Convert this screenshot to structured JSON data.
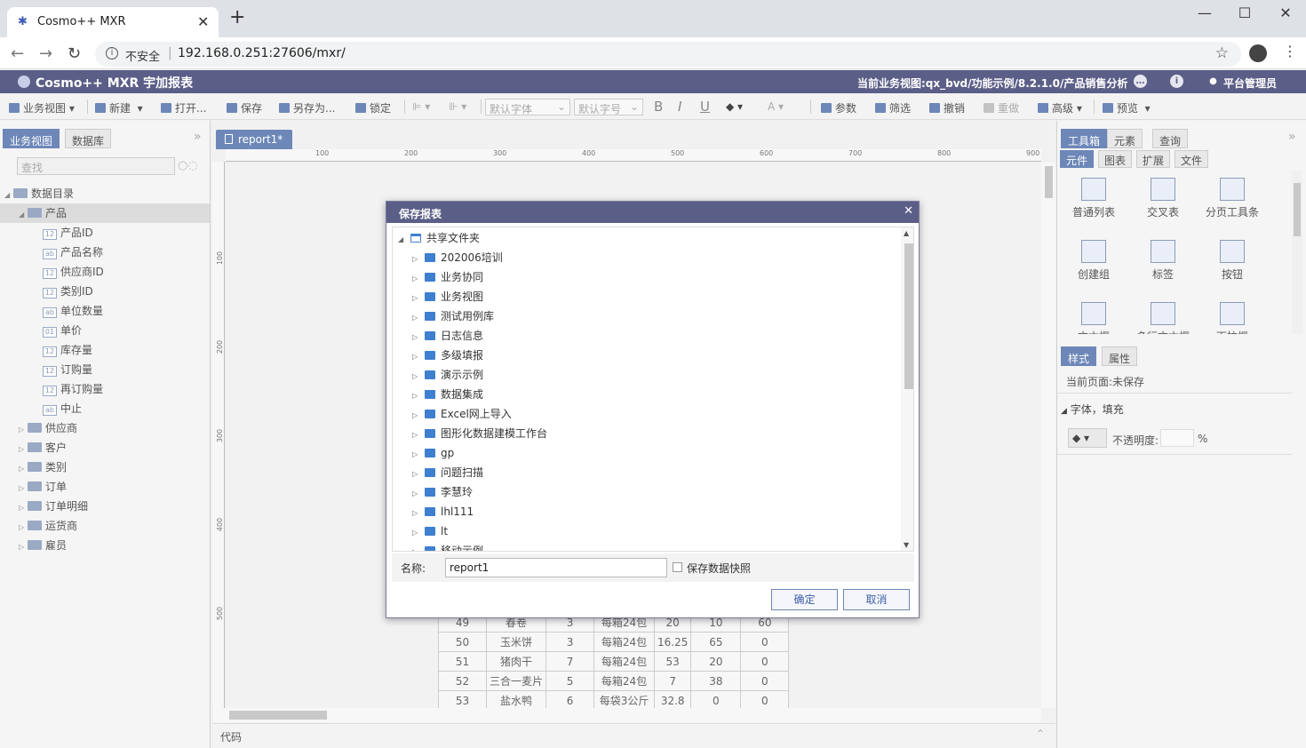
{
  "browser": {
    "tab_title": "Cosmo++ MXR",
    "tab_close": "✕",
    "new_tab": "+",
    "insecure_label": "不安全",
    "url": "192.168.0.251:27606/mxr/",
    "min": "—",
    "max": "☐",
    "close": "✕"
  },
  "header": {
    "app_name": "Cosmo++ MXR 宇加报表",
    "current_view": "当前业务视图:qx_bvd/功能示例/8.2.1.0/产品销售分析",
    "user": "平台管理员"
  },
  "toolbar": {
    "business_view": "业务视图",
    "new": "新建",
    "open": "打开...",
    "save": "保存",
    "save_as": "另存为...",
    "lock": "锁定",
    "font": "默认字体",
    "font_size": "默认字号",
    "bold": "B",
    "italic": "I",
    "underline": "U",
    "params": "参数",
    "filter": "筛选",
    "undo": "撤销",
    "redo": "重做",
    "advanced": "高级",
    "preview": "预览"
  },
  "left_panel": {
    "tabs": [
      "业务视图",
      "数据库"
    ],
    "search_placeholder": "查找",
    "root": "数据目录",
    "product": "产品",
    "fields": [
      {
        "type": "12",
        "label": "产品ID"
      },
      {
        "type": "ab",
        "label": "产品名称"
      },
      {
        "type": "12",
        "label": "供应商ID"
      },
      {
        "type": "12",
        "label": "类别ID"
      },
      {
        "type": "ab",
        "label": "单位数量"
      },
      {
        "type": "01",
        "label": "单价"
      },
      {
        "type": "12",
        "label": "库存量"
      },
      {
        "type": "12",
        "label": "订购量"
      },
      {
        "type": "12",
        "label": "再订购量"
      },
      {
        "type": "ab",
        "label": "中止"
      }
    ],
    "tables": [
      "供应商",
      "客户",
      "类别",
      "订单",
      "订单明细",
      "运货商",
      "雇员"
    ]
  },
  "center": {
    "tab": "report1*",
    "ruler_h": [
      "100",
      "200",
      "300",
      "400",
      "500",
      "600",
      "700",
      "800",
      "900"
    ],
    "ruler_v": [
      "100",
      "200",
      "300",
      "400",
      "500"
    ],
    "rows": [
      [
        "49",
        "春卷",
        "3",
        "每箱24包",
        "20",
        "10",
        "60"
      ],
      [
        "50",
        "玉米饼",
        "3",
        "每箱24包",
        "16.25",
        "65",
        "0"
      ],
      [
        "51",
        "猪肉干",
        "7",
        "每箱24包",
        "53",
        "20",
        "0"
      ],
      [
        "52",
        "三合一麦片",
        "5",
        "每箱24包",
        "7",
        "38",
        "0"
      ],
      [
        "53",
        "盐水鸭",
        "6",
        "每袋3公斤",
        "32.8",
        "0",
        "0"
      ]
    ],
    "code_label": "代码"
  },
  "right_panel": {
    "tabs": [
      "工具箱",
      "元素",
      "查询"
    ],
    "sub_tabs": [
      "元件",
      "图表",
      "扩展",
      "文件"
    ],
    "components": [
      "普通列表",
      "交叉表",
      "分页工具条",
      "创建组",
      "标签",
      "按钮",
      "文本框",
      "多行文本框",
      "下拉框"
    ],
    "prop_tabs": [
      "样式",
      "属性"
    ],
    "current_page": "当前页面:未保存",
    "section": "字体，填充",
    "opacity_label": "不透明度:",
    "percent": "%"
  },
  "dialog": {
    "title": "保存报表",
    "root": "共享文件夹",
    "folders": [
      "202006培训",
      "业务协同",
      "业务视图",
      "测试用例库",
      "日志信息",
      "多级填报",
      "演示示例",
      "数据集成",
      "Excel网上导入",
      "图形化数据建模工作台",
      "gp",
      "问题扫描",
      "李慧玲",
      "lhl111",
      "lt",
      "移动示例"
    ],
    "name_label": "名称:",
    "name_value": "report1",
    "snapshot_label": "保存数据快照",
    "ok": "确定",
    "cancel": "取消"
  }
}
